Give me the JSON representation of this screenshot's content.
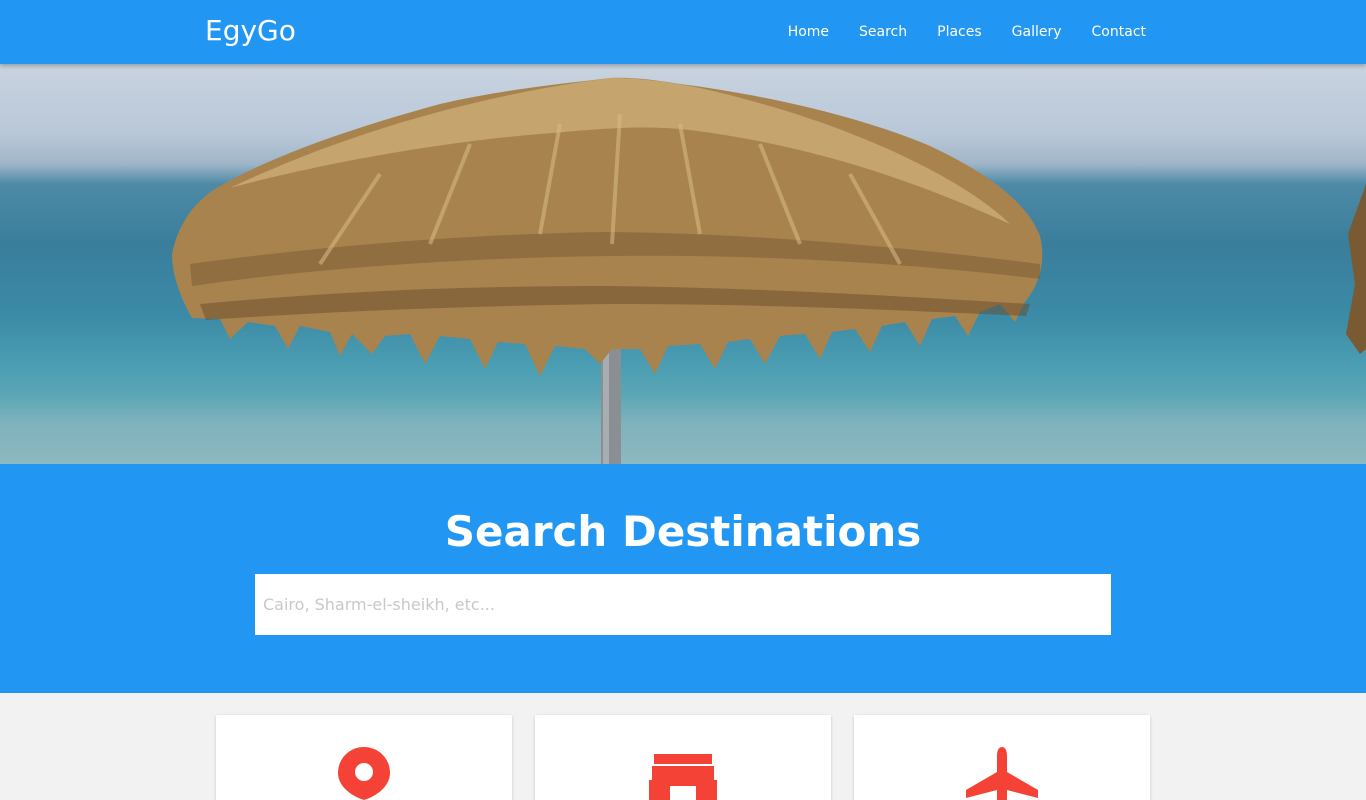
{
  "brand": "EgyGo",
  "nav": {
    "home": "Home",
    "search": "Search",
    "places": "Places",
    "gallery": "Gallery",
    "contact": "Contact"
  },
  "search": {
    "title": "Search Destinations",
    "placeholder": "Cairo, Sharm-el-sheikh, etc..."
  },
  "cards": [
    {
      "icon": "location-pin-icon"
    },
    {
      "icon": "store-icon"
    },
    {
      "icon": "airplane-icon"
    }
  ],
  "colors": {
    "primary": "#2196f3",
    "accent": "#f44336",
    "background": "#f2f2f2"
  }
}
